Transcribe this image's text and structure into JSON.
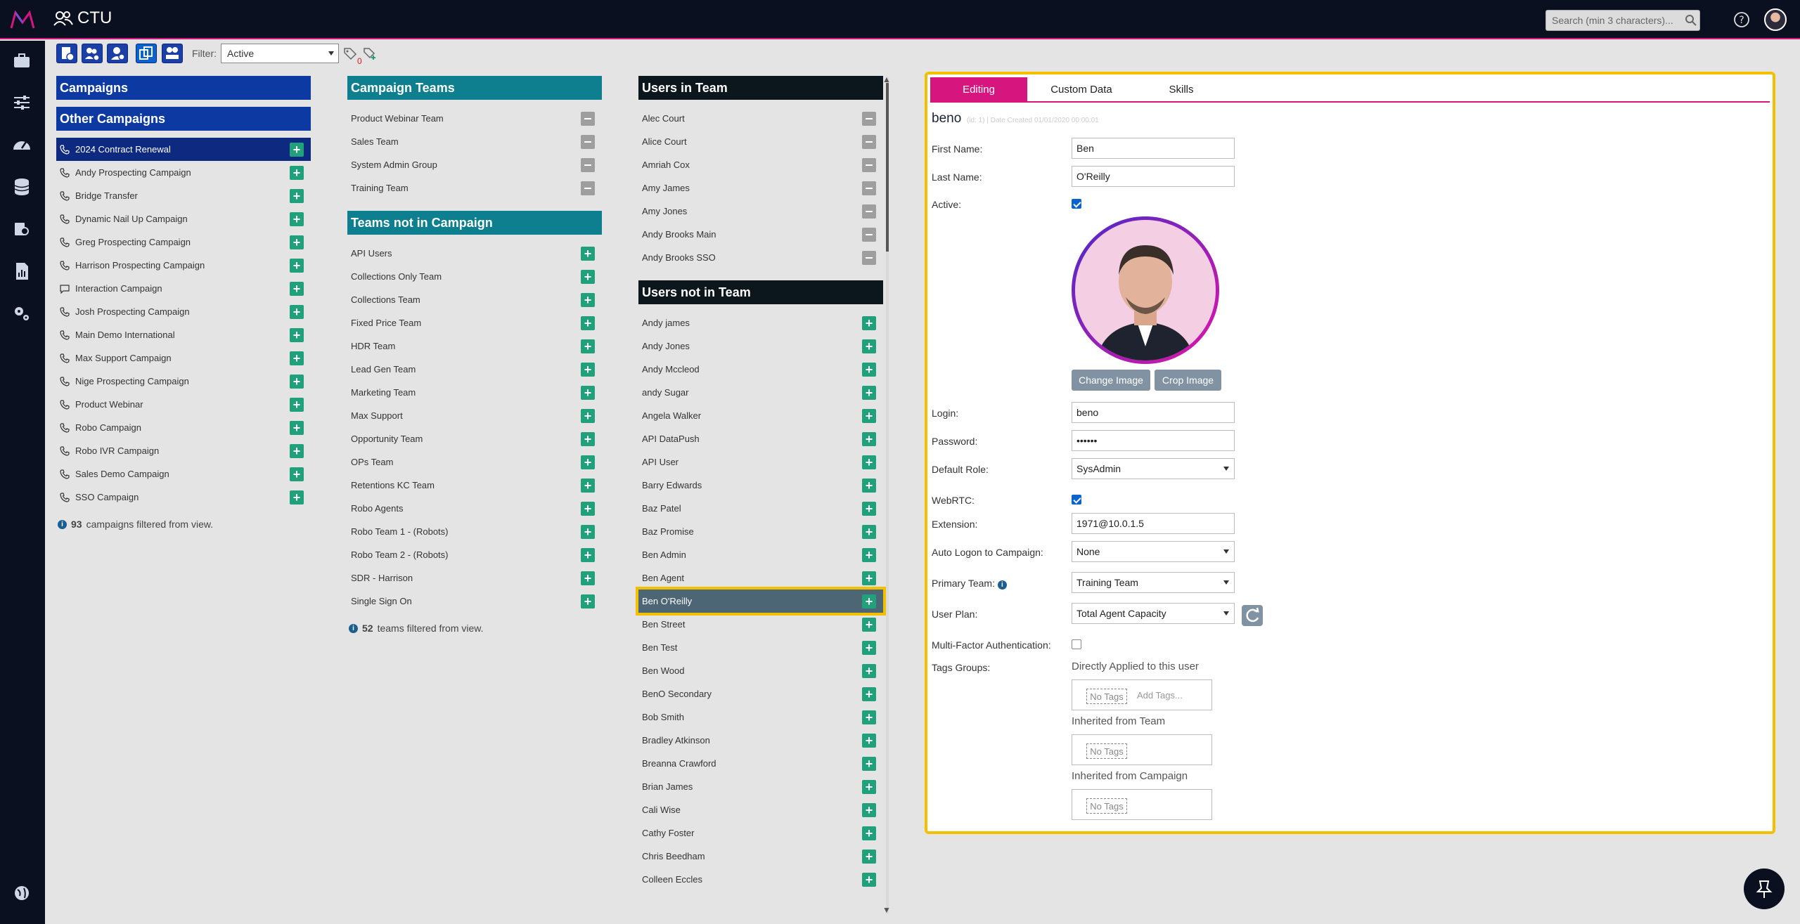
{
  "app": {
    "title": "CTU",
    "search_placeholder": "Search (min 3 characters)..."
  },
  "toolbar": {
    "filter_label": "Filter:",
    "filter_value": "Active",
    "tag_count": "0"
  },
  "campaigns": {
    "header": "Campaigns",
    "other_header": "Other Campaigns",
    "items": [
      "2024 Contract Renewal",
      "Andy Prospecting Campaign",
      "Bridge Transfer",
      "Dynamic Nail Up Campaign",
      "Greg Prospecting Campaign",
      "Harrison Prospecting Campaign",
      "Interaction Campaign",
      "Josh Prospecting Campaign",
      "Main Demo International",
      "Max Support Campaign",
      "Nige Prospecting Campaign",
      "Product Webinar",
      "Robo Campaign",
      "Robo IVR Campaign",
      "Sales Demo Campaign",
      "SSO Campaign"
    ],
    "filtered_count": "93",
    "filtered_text": "campaigns filtered from view."
  },
  "campaign_teams": {
    "header": "Campaign Teams",
    "items": [
      "Product Webinar Team",
      "Sales Team",
      "System Admin Group",
      "Training Team"
    ],
    "not_in_header": "Teams not in Campaign",
    "not_in_items": [
      "API Users",
      "Collections Only Team",
      "Collections Team",
      "Fixed Price Team",
      "HDR Team",
      "Lead Gen Team",
      "Marketing Team",
      "Max Support",
      "Opportunity Team",
      "OPs Team",
      "Retentions KC Team",
      "Robo Agents",
      "Robo Team 1 - (Robots)",
      "Robo Team 2 - (Robots)",
      "SDR - Harrison",
      "Single Sign On"
    ],
    "filtered_count": "52",
    "filtered_text": "teams filtered from view."
  },
  "users_in_team": {
    "header": "Users in Team",
    "items": [
      "Alec Court",
      "Alice Court",
      "Amriah Cox",
      "Amy James",
      "Amy Jones",
      "Andy Brooks Main",
      "Andy Brooks SSO"
    ]
  },
  "users_not_in_team": {
    "header": "Users not in Team",
    "items": [
      "Andy james",
      "Andy Jones",
      "Andy Mccleod",
      "andy Sugar",
      "Angela Walker",
      "API DataPush",
      "API User",
      "Barry Edwards",
      "Baz Patel",
      "Baz Promise",
      "Ben Admin",
      "Ben Agent",
      "Ben O'Reilly",
      "Ben Street",
      "Ben Test",
      "Ben Wood",
      "BenO Secondary",
      "Bob Smith",
      "Bradley Atkinson",
      "Breanna Crawford",
      "Brian James",
      "Cali Wise",
      "Cathy Foster",
      "Chris Beedham",
      "Colleen Eccles"
    ]
  },
  "editor": {
    "tabs": [
      "Editing",
      "Custom Data",
      "Skills"
    ],
    "username": "beno",
    "meta": "(id: 1) | Date Created 01/01/2020 00:00:01",
    "first_name_label": "First Name:",
    "first_name": "Ben",
    "last_name_label": "Last Name:",
    "last_name": "O'Reilly",
    "active_label": "Active:",
    "change_image": "Change Image",
    "crop_image": "Crop Image",
    "login_label": "Login:",
    "login": "beno",
    "password_label": "Password:",
    "password": "••••••",
    "role_label": "Default Role:",
    "role": "SysAdmin",
    "webrtc_label": "WebRTC:",
    "extension_label": "Extension:",
    "extension": "1971@10.0.1.5",
    "auto_logon_label": "Auto Logon to Campaign:",
    "auto_logon": "None",
    "primary_team_label": "Primary Team:",
    "primary_team": "Training Team",
    "user_plan_label": "User Plan:",
    "user_plan": "Total Agent Capacity",
    "mfa_label": "Multi-Factor Authentication:",
    "tags_label": "Tags Groups:",
    "tags_direct": "Directly Applied to this user",
    "tags_team": "Inherited from Team",
    "tags_campaign": "Inherited from Campaign",
    "no_tags": "No Tags",
    "add_tags": "Add Tags..."
  },
  "colors": {
    "accent": "#d6157f",
    "primary": "#0d3aa2",
    "teal": "#0e7f8f",
    "highlight": "#f3c000"
  }
}
